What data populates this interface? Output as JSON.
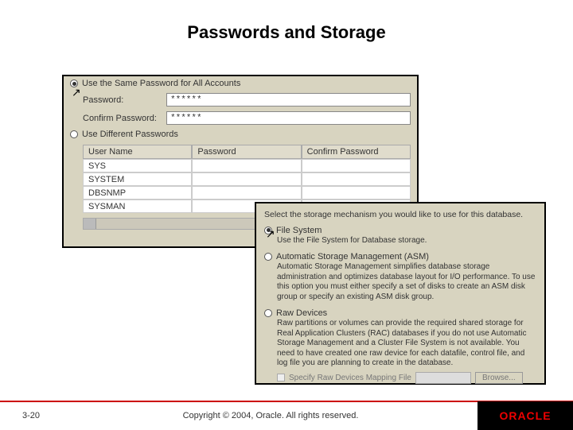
{
  "title": "Passwords and Storage",
  "panel1": {
    "samePassLabel": "Use the Same Password for All Accounts",
    "passwordLabel": "Password:",
    "passwordValue": "******",
    "confirmLabel": "Confirm Password:",
    "confirmValue": "******",
    "diffPassLabel": "Use Different Passwords",
    "table": {
      "headers": [
        "User Name",
        "Password",
        "Confirm Password"
      ],
      "rows": [
        "SYS",
        "SYSTEM",
        "DBSNMP",
        "SYSMAN"
      ]
    }
  },
  "panel2": {
    "intro": "Select the storage mechanism you would like to use for this database.",
    "opt1": {
      "label": "File System",
      "desc": "Use the File System for Database storage."
    },
    "opt2": {
      "label": "Automatic Storage Management (ASM)",
      "desc": "Automatic Storage Management simplifies database storage administration and optimizes database layout for I/O performance. To use this option you must either specify a set of disks to create an ASM disk group or specify an existing ASM disk group."
    },
    "opt3": {
      "label": "Raw Devices",
      "desc": "Raw partitions or volumes can provide the required shared storage for Real Application Clusters (RAC) databases if you do not use Automatic Storage Management and a Cluster File System is not available. You need to have created one raw device for each datafile, control file, and log file you are planning to create in the database."
    },
    "specify": "Specify Raw Devices Mapping File",
    "browse": "Browse..."
  },
  "footer": {
    "page": "3-20",
    "copy": "Copyright © 2004, Oracle. All rights reserved.",
    "logo": "ORACLE"
  }
}
